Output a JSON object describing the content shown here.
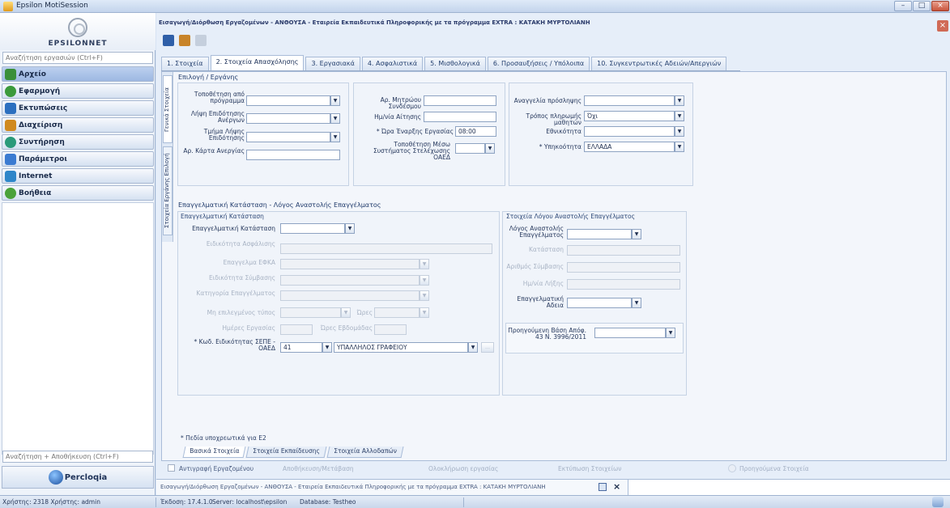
{
  "app": {
    "title": "Epsilon MotiSession",
    "window_buttons": [
      "–",
      "□",
      "×"
    ]
  },
  "sidebar": {
    "logo_text": "EPSILONNET",
    "search_placeholder": "Αναζήτηση εργασιών (Ctrl+F)",
    "items": [
      {
        "label": "Αρχείο",
        "icon": "file-icon",
        "color": "#3a8f3a"
      },
      {
        "label": "Εφαρμογή",
        "icon": "app-icon",
        "color": "#3b9a3b"
      },
      {
        "label": "Εκτυπώσεις",
        "icon": "print-icon",
        "color": "#2b6fbf"
      },
      {
        "label": "Διαχείριση",
        "icon": "manage-icon",
        "color": "#d08a1f"
      },
      {
        "label": "Συντήρηση",
        "icon": "maintenance-icon",
        "color": "#2a9a7a"
      },
      {
        "label": "Παράμετροι",
        "icon": "parameters-icon",
        "color": "#3b7bd1"
      },
      {
        "label": "Internet",
        "icon": "internet-icon",
        "color": "#2e86c9"
      },
      {
        "label": "Βοήθεια",
        "icon": "help-icon",
        "color": "#4aa23a"
      }
    ],
    "bottom_search_placeholder": "Αναζήτηση + Αποθήκευση (Ctrl+F)",
    "brand": "Percloqia"
  },
  "doc": {
    "title": "Εισαγωγή/Διόρθωση Εργαζομένων - ΑΝΘΟΥΣΑ - Εταιρεία Εκπαιδευτικά Πληροφορικής με τα πρόγραμμα EXTRA : ΚΑΤΑΚΗ ΜΥΡΤΟΛΙΑΝΗ",
    "close": "×"
  },
  "tabs": [
    {
      "label": "1. Στοιχεία"
    },
    {
      "label": "2. Στοιχεία Απασχόλησης",
      "active": true
    },
    {
      "label": "3. Εργασιακά"
    },
    {
      "label": "4. Ασφαλιστικά"
    },
    {
      "label": "5. Μισθολογικά"
    },
    {
      "label": "6. Προσαυξήσεις / Υπόλοιπα"
    },
    {
      "label": "10. Συγκεντρωτικές Αδειών/Απεργιών"
    }
  ],
  "vtabs": [
    "Γενικά Στοιχεία",
    "Στοιχεία Εργάνης Επιλογή"
  ],
  "section1": {
    "header": "Επιλογή / Εργάνης",
    "col1": {
      "labels": [
        "Τοποθέτηση από πρόγραμμα",
        "Λήψη Επιδότησης Ανέργων",
        "Τμήμα Λήψης Επιδότησης",
        "Αρ. Κάρτα Ανεργίας"
      ]
    },
    "col2": {
      "labels": [
        "Αρ. Μητρώου Συνδέσμου",
        "Ημ/νία Αίτησης",
        "* Ώρα Έναρξης Εργασίας",
        "Τοποθέτηση Μέσω Συστήματος Στελέχωσης ΟΑΕΔ"
      ],
      "start_time": "08:00"
    },
    "col3": {
      "labels": [
        "Αναγγελία πρόσληψης",
        "Τρόπος πληρωμής μαθητών",
        "Εθνικότητα",
        "* Υπηκοότητα"
      ],
      "values": [
        "",
        "Όχι",
        "",
        "ΕΛΛΑΔΑ"
      ]
    }
  },
  "section2": {
    "header": "Επαγγελματική Κατάσταση - Λόγος Αναστολής Επαγγέλματος",
    "left": {
      "title": "Επαγγελματική Κατάσταση",
      "labels": [
        "Επαγγελματική Κατάσταση",
        "Ειδικότητα Ασφάλισης",
        "Επαγγελμα ΕΦΚΑ",
        "Ειδικότητα Σύμβασης",
        "Κατηγορία Επαγγέλματος",
        "Μη επιλεγμένος τύπος",
        "Ώρες",
        "Ημέρες Εργασίας",
        "Ώρες Εβδομάδας"
      ],
      "specialty_label": "* Κωδ. Ειδικότητας ΣΕΠΕ - ΟΑΕΔ",
      "specialty_code": "41",
      "specialty_text": "ΥΠΑΛΛΗΛΟΣ ΓΡΑΦΕΙΟΥ"
    },
    "right": {
      "title": "Στοιχεία Λόγου Αναστολής Επαγγέλματος",
      "labels": [
        "Λόγος Αναστολής Επαγγέλματος",
        "Κατάσταση",
        "Αριθμός Σύμβασης",
        "Ημ/νία Λήξης",
        "Επαγγελματική Αδεια"
      ],
      "prev_label": "Προηγούμενη Βάση Απόφ. 43 Ν. 3996/2011"
    },
    "footnote": "* Πεδία υποχρεωτικά για Ε2",
    "bottom_tabs": [
      "Βασικά Στοιχεία",
      "Στοιχεία Εκπαίδευσης",
      "Στοιχεία Αλλοδαπών"
    ]
  },
  "actionbar": {
    "checkbox_label": "Αντιγραφή Εργαζομένου",
    "items": [
      "Αποθήκευση/Μετάβαση",
      "Ολοκλήρωση εργασίας",
      "Εκτύπωση Στοιχείων",
      "Προηγούμενα Στοιχεία"
    ]
  },
  "doc_tab": {
    "label": "Εισαγωγή/Διόρθωση Εργαζομένων - ΑΝΘΟΥΣΑ - Εταιρεία Εκπαιδευτικά Πληροφορικής με τα πρόγραμμα EXTRA : ΚΑΤΑΚΗ ΜΥΡΤΟΛΙΑΝΗ",
    "close": "×"
  },
  "status": {
    "user": "Χρήστης: 2318 Χρήστης: admin",
    "version": "Έκδοση: 17.4.1.0",
    "server": "Server: localhost\\epsilon",
    "database": "Database: Testheo"
  }
}
